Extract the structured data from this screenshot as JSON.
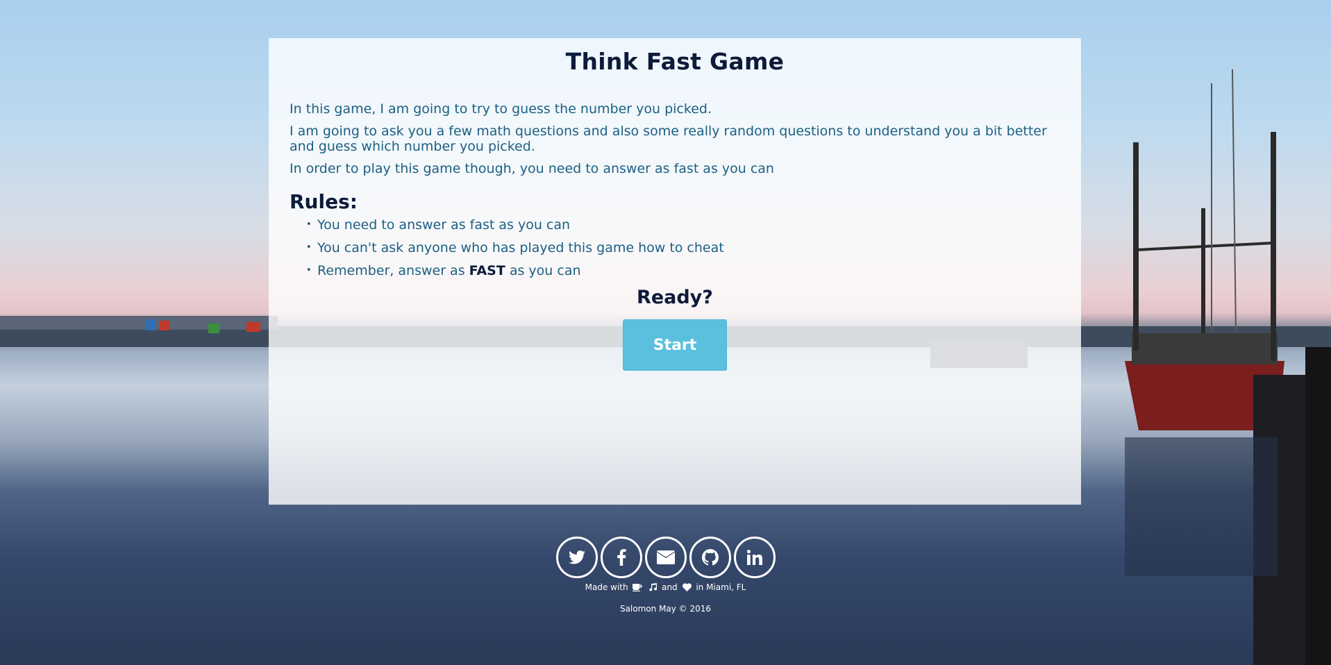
{
  "page": {
    "title": "Think Fast Game",
    "intro": [
      "In this game, I am going to try to guess the number you picked.",
      "I am going to ask you a few math questions and also some really random questions to understand you a bit better and guess which number you picked.",
      "In order to play this game though, you need to answer as fast as you can"
    ],
    "rules_heading": "Rules:",
    "rules": {
      "r1": "You need to answer as fast as you can",
      "r2": "You can't ask anyone who has played this game how to cheat",
      "r3_before": "Remember, answer as ",
      "r3_bold": "FAST",
      "r3_after": " as you can"
    },
    "ready": "Ready?",
    "start_label": "Start"
  },
  "colors": {
    "accent": "#5bc0de",
    "heading": "#0d1b3a",
    "body_text": "#1c5f82"
  },
  "social": {
    "icons": [
      "twitter-icon",
      "facebook-icon",
      "envelope-icon",
      "github-icon",
      "linkedin-icon"
    ]
  },
  "footer": {
    "made_prefix": "Made with",
    "made_and": "and",
    "made_suffix": "in Miami, FL",
    "copyright": "Salomon May © 2016"
  }
}
